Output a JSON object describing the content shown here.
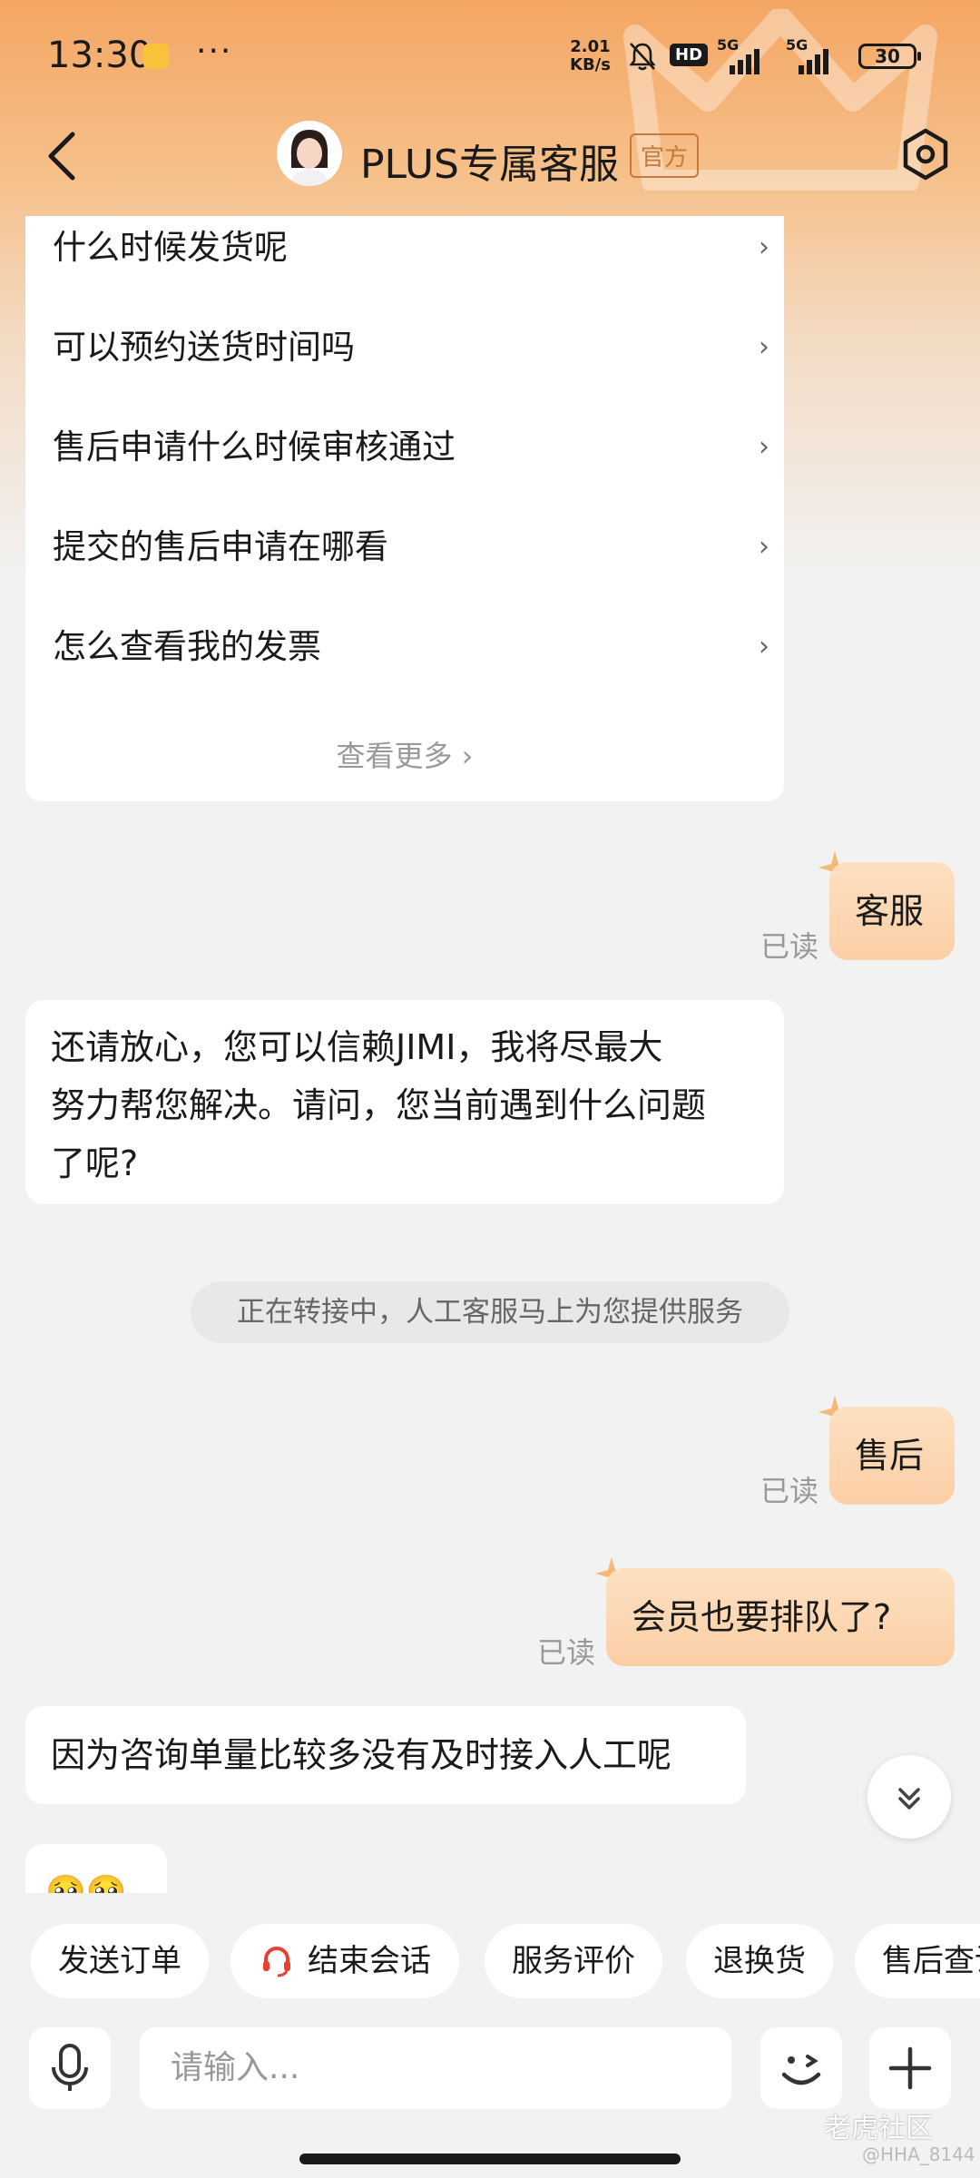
{
  "status_bar": {
    "time": "13:30",
    "dots": "···",
    "net_speed_value": "2.01",
    "net_speed_unit": "KB/s",
    "hd_label": "HD",
    "signal1_label": "5G",
    "signal2_label": "5G",
    "battery": "30"
  },
  "header": {
    "title": "PLUS专属客服",
    "official_badge": "官方"
  },
  "faq": {
    "items": [
      {
        "label": "什么时候发货呢"
      },
      {
        "label": "可以预约送货时间吗"
      },
      {
        "label": "售后申请什么时候审核通过"
      },
      {
        "label": "提交的售后申请在哪看"
      },
      {
        "label": "怎么查看我的发票"
      }
    ],
    "chevron": "›",
    "see_more": "查看更多 ›"
  },
  "messages": {
    "read_label": "已读",
    "out1": "客服",
    "in1_line1": "还请放心，您可以信赖JIMI，我将尽最大",
    "in1_line2": "努力帮您解决。请问，您当前遇到什么问题",
    "in1_line3": "了呢?",
    "system": "正在转接中，人工客服马上为您提供服务",
    "out2": "售后",
    "out3": "会员也要排队了?",
    "in2": "因为咨询单量比较多没有及时接入人工呢",
    "in3_emoji": "🥺🥺"
  },
  "quick_actions": [
    {
      "label": "发送订单"
    },
    {
      "label": "结束会话"
    },
    {
      "label": "服务评价"
    },
    {
      "label": "退换货"
    },
    {
      "label": "售后查询"
    }
  ],
  "input": {
    "placeholder": "请输入..."
  },
  "watermark": {
    "main": "老虎社区",
    "sub": "@HHA_8144"
  },
  "colors": {
    "accent": "#f4a663",
    "bubble_out": "#fbcfa5",
    "end_chat_icon": "#e8402c"
  }
}
